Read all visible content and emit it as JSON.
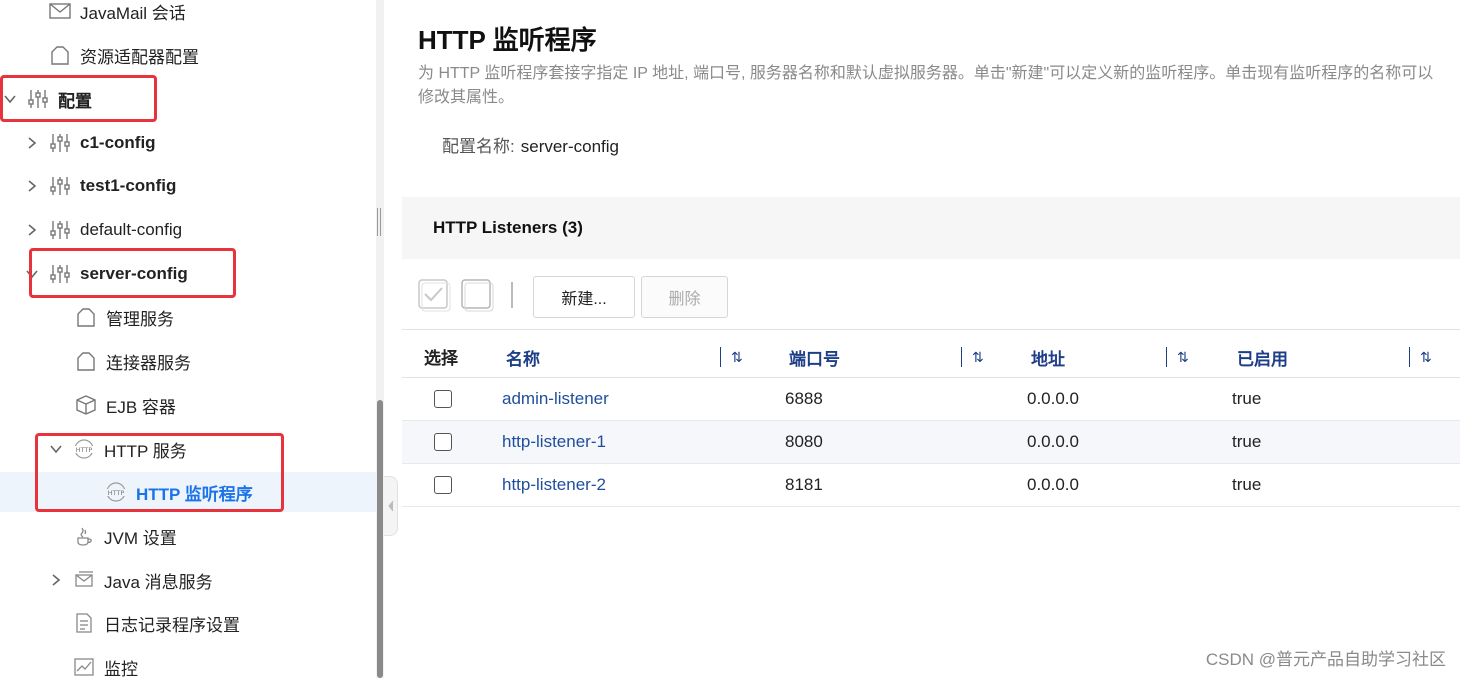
{
  "sidebar": {
    "items": [
      {
        "label": "JavaMail 会话",
        "icon": "envelope-icon"
      },
      {
        "label": "资源适配器配置",
        "icon": "connector-icon"
      },
      {
        "label": "配置",
        "icon": "sliders-icon",
        "expanded": true
      },
      {
        "label": "c1-config",
        "icon": "sliders-icon"
      },
      {
        "label": "test1-config",
        "icon": "sliders-icon"
      },
      {
        "label": "default-config",
        "icon": "sliders-icon"
      },
      {
        "label": "server-config",
        "icon": "sliders-icon",
        "expanded": true
      },
      {
        "label": "管理服务",
        "icon": "connector-icon"
      },
      {
        "label": "连接器服务",
        "icon": "connector-icon"
      },
      {
        "label": "EJB 容器",
        "icon": "cube-icon"
      },
      {
        "label": "HTTP 服务",
        "icon": "http-icon",
        "expanded": true
      },
      {
        "label": "HTTP 监听程序",
        "icon": "http-icon",
        "selected": true
      },
      {
        "label": "JVM 设置",
        "icon": "java-icon"
      },
      {
        "label": "Java 消息服务",
        "icon": "message-icon"
      },
      {
        "label": "日志记录程序设置",
        "icon": "log-icon"
      },
      {
        "label": "监控",
        "icon": "monitor-icon"
      }
    ]
  },
  "page": {
    "title": "HTTP 监听程序",
    "description": "为 HTTP 监听程序套接字指定 IP 地址, 端口号, 服务器名称和默认虚拟服务器。单击\"新建\"可以定义新的监听程序。单击现有监听程序的名称可以修改其属性。",
    "config_label": "配置名称:",
    "config_value": "server-config"
  },
  "table": {
    "caption": "HTTP Listeners (3)",
    "new_button": "新建...",
    "delete_button": "删除",
    "columns": {
      "select": "选择",
      "name": "名称",
      "port": "端口号",
      "address": "地址",
      "enabled": "已启用"
    },
    "rows": [
      {
        "name": "admin-listener",
        "port": "6888",
        "address": "0.0.0.0",
        "enabled": "true"
      },
      {
        "name": "http-listener-1",
        "port": "8080",
        "address": "0.0.0.0",
        "enabled": "true"
      },
      {
        "name": "http-listener-2",
        "port": "8181",
        "address": "0.0.0.0",
        "enabled": "true"
      }
    ]
  },
  "watermark": "CSDN @普元产品自助学习社区",
  "colors": {
    "accent": "#1a73e8",
    "link": "#1f4e9c",
    "header_blue": "#1f3e88",
    "highlight_red": "#e8323c",
    "selected_bg": "#eef4fb"
  }
}
